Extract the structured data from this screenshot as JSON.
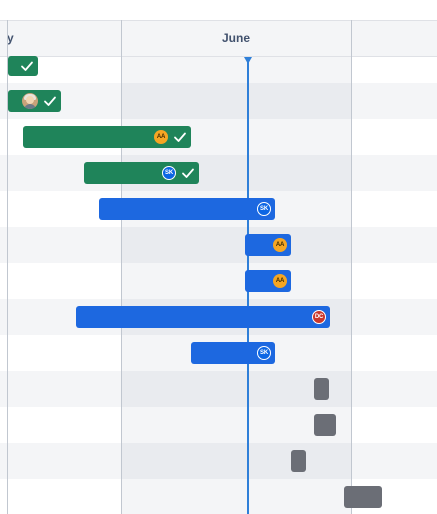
{
  "timeline": {
    "months": [
      {
        "label": "y",
        "key": "prev"
      },
      {
        "label": "June",
        "key": "june"
      }
    ],
    "today_marker": true,
    "colors": {
      "done": "#1f845a",
      "in_progress": "#1d68e0",
      "todo": "#6b6e76",
      "today_line": "#2f7fd8"
    },
    "rows": [
      {
        "status": "done",
        "assignee": "",
        "avatar_icon": "",
        "icon": "check-icon"
      },
      {
        "status": "done",
        "assignee": "",
        "avatar_icon": "user-photo-avatar",
        "icon": "check-icon"
      },
      {
        "status": "done",
        "assignee": "AA",
        "icon": "check-icon"
      },
      {
        "status": "done",
        "assignee": "SK",
        "icon": "check-icon"
      },
      {
        "status": "in_progress",
        "assignee": "SK"
      },
      {
        "status": "in_progress",
        "assignee": "AA"
      },
      {
        "status": "in_progress",
        "assignee": "AA"
      },
      {
        "status": "in_progress",
        "assignee": "DC"
      },
      {
        "status": "in_progress",
        "assignee": "SK"
      },
      {
        "status": "todo",
        "assignee": ""
      },
      {
        "status": "todo",
        "assignee": ""
      },
      {
        "status": "todo",
        "assignee": ""
      },
      {
        "status": "todo",
        "assignee": ""
      }
    ]
  }
}
